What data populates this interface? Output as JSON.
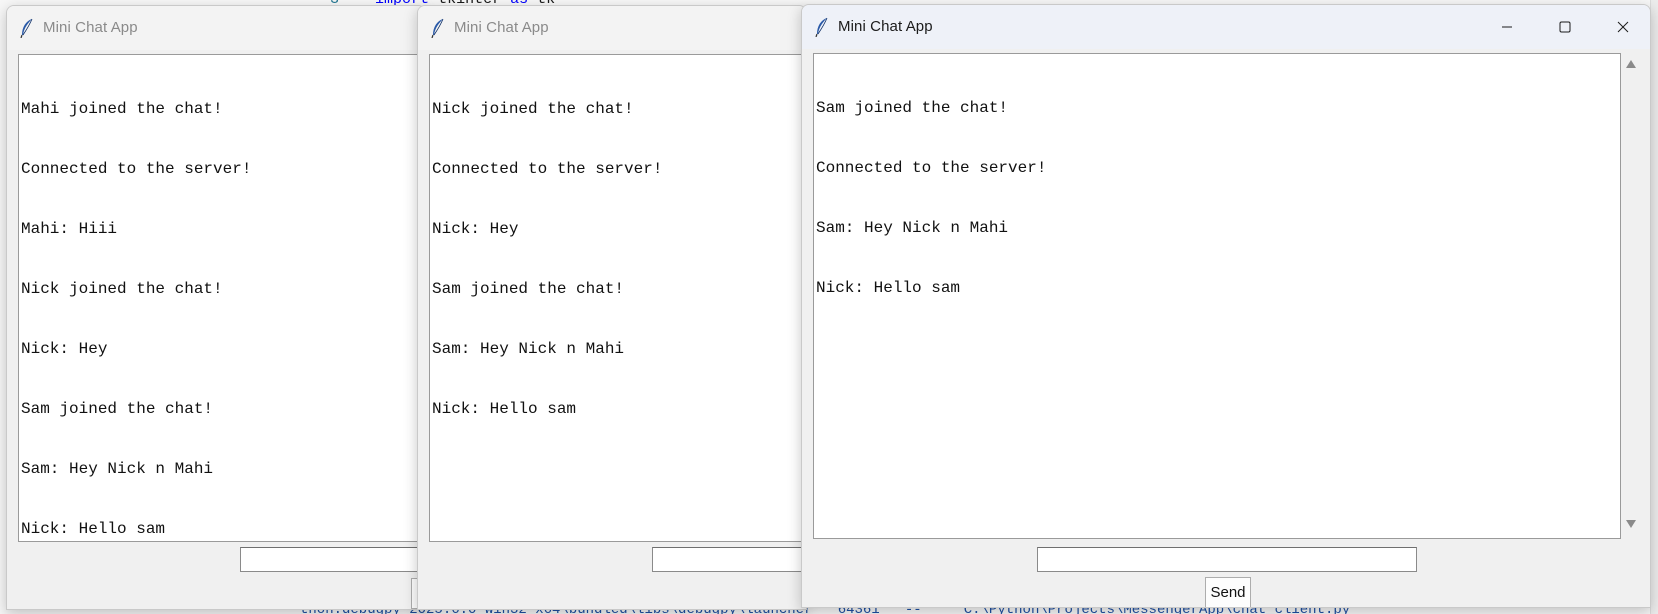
{
  "background": {
    "code_line_number": "3",
    "code_tokens": [
      "import",
      "tkinter",
      "as",
      "tk"
    ],
    "terminal_text_left": "thon.debugpy-2025.6.0-win32-x64\\bundled\\libs\\debugpy\\launcher' '64361' '--'",
    "terminal_text_right": "'C:\\Python\\Projects\\MessengerApp\\chat_client.py'"
  },
  "windows": [
    {
      "title": "Mini Chat App",
      "state": "inactive",
      "messages": [
        "Mahi joined the chat!",
        "Connected to the server!",
        "Mahi: Hiii",
        "Nick joined the chat!",
        "Nick: Hey",
        "Sam joined the chat!",
        "Sam: Hey Nick n Mahi",
        "Nick: Hello sam"
      ],
      "input_value": ""
    },
    {
      "title": "Mini Chat App",
      "state": "inactive",
      "messages": [
        "Nick joined the chat!",
        "Connected to the server!",
        "Nick: Hey",
        "Sam joined the chat!",
        "Sam: Hey Nick n Mahi",
        "Nick: Hello sam"
      ],
      "input_value": ""
    },
    {
      "title": "Mini Chat App",
      "state": "active",
      "messages": [
        "Sam joined the chat!",
        "Connected to the server!",
        "Sam: Hey Nick n Mahi",
        "Nick: Hello sam"
      ],
      "input_value": "",
      "send_label": "Send",
      "controls": [
        "minimize-icon",
        "maximize-icon",
        "close-icon"
      ]
    }
  ],
  "colors": {
    "window_bg": "#f0f0f0",
    "active_titlebar": "#eef1f8",
    "text_area_bg": "#ffffff"
  }
}
